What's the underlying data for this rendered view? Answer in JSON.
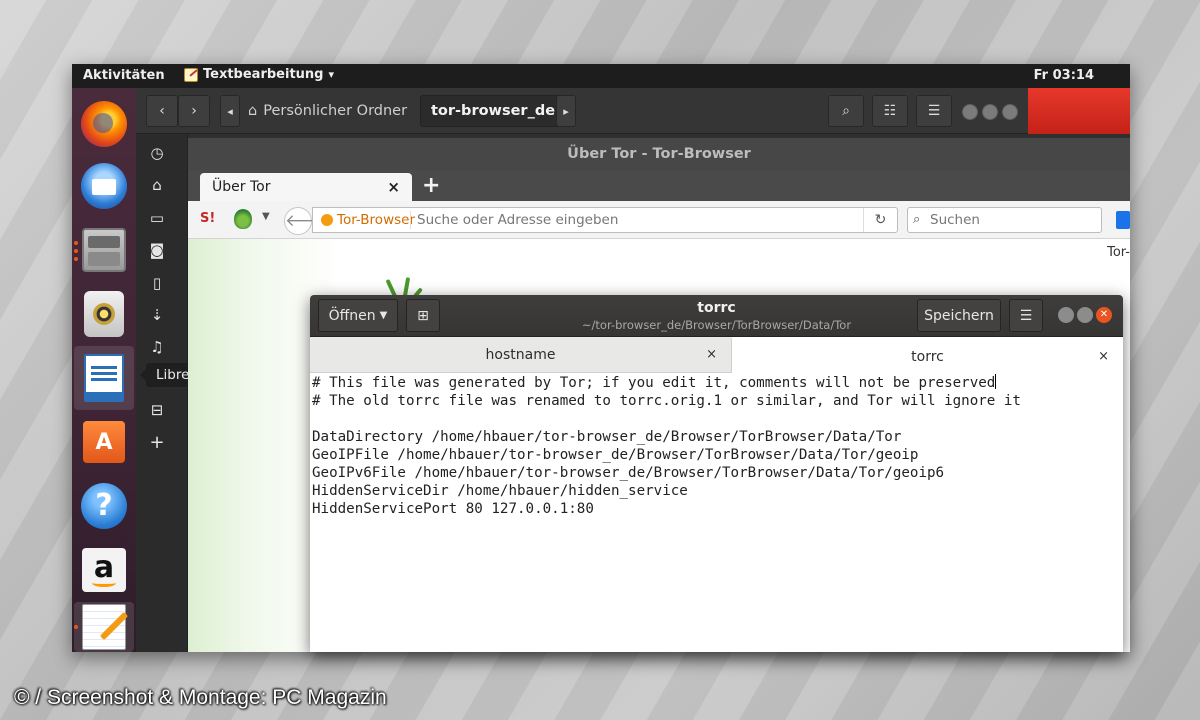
{
  "topbar": {
    "activities": "Aktivitäten",
    "app_menu": "Textbearbeitung",
    "app_menu_arrow": "▾",
    "clock": "Fr 03:14"
  },
  "dock": {
    "items": [
      "firefox-icon",
      "thunderbird-icon",
      "files-icon",
      "rhythmbox-icon",
      "libreoffice-writer-icon",
      "software-center-icon",
      "help-icon",
      "amazon-icon",
      "text-editor-icon"
    ],
    "tooltip": "LibreOffice Writer",
    "accent": "#e95420"
  },
  "file_manager": {
    "breadcrumb_home": "Persönlicher Ordner",
    "breadcrumb_current": "tor-browser_de",
    "sidebar_icons": [
      "recent-icon",
      "home-icon",
      "folder-icon",
      "camera-icon",
      "document-icon",
      "download-icon",
      "music-icon",
      "trash-icon",
      "add-icon"
    ]
  },
  "tor_browser": {
    "window_title": "Über Tor - Tor-Browser",
    "tab_label": "Über Tor",
    "identity_label": "Tor-Browser",
    "url_placeholder": "Suche oder Adresse eingeben",
    "search_placeholder": "Suchen",
    "corner_text": "Tor-"
  },
  "gedit": {
    "open_label": "Öffnen",
    "title": "torrc",
    "subtitle": "~/tor-browser_de/Browser/TorBrowser/Data/Tor",
    "save_label": "Speichern",
    "tabs": [
      {
        "label": "hostname",
        "active": false
      },
      {
        "label": "torrc",
        "active": true
      }
    ],
    "lines": [
      "# This file was generated by Tor; if you edit it, comments will not be preserved",
      "# The old torrc file was renamed to torrc.orig.1 or similar, and Tor will ignore it",
      "",
      "DataDirectory /home/hbauer/tor-browser_de/Browser/TorBrowser/Data/Tor",
      "GeoIPFile /home/hbauer/tor-browser_de/Browser/TorBrowser/Data/Tor/geoip",
      "GeoIPv6File /home/hbauer/tor-browser_de/Browser/TorBrowser/Data/Tor/geoip6",
      "HiddenServiceDir /home/hbauer/hidden_service",
      "HiddenServicePort 80 127.0.0.1:80"
    ]
  },
  "credit": "© / Screenshot & Montage: PC Magazin"
}
